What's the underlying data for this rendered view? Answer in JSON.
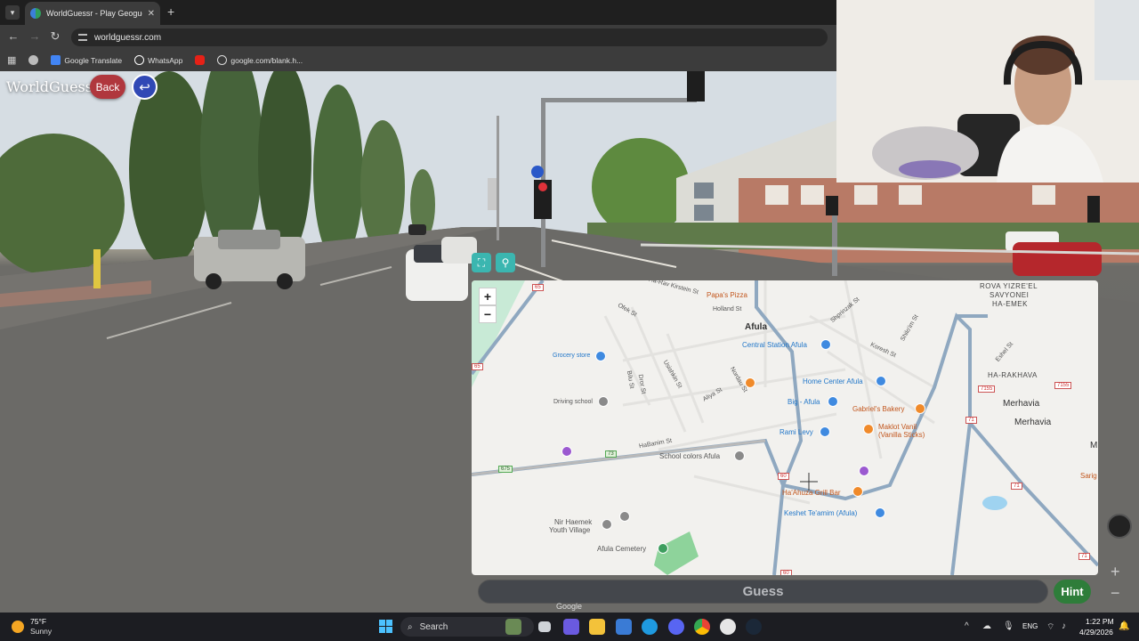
{
  "browser": {
    "tab_title": "WorldGuessr - Play Geoguessr",
    "tab_close": "✕",
    "new_tab": "+",
    "url": "worldguessr.com",
    "bookmarks": [
      "Google Translate",
      "WhatsApp",
      "google.com/blank.h..."
    ]
  },
  "game": {
    "logo": "WorldGuessr",
    "back_label": "Back",
    "guess_label": "Guess",
    "hint_label": "Hint",
    "google_watermark": "Google"
  },
  "map": {
    "places": {
      "afula": "Afula",
      "rova": "ROVA YIZRE'EL",
      "savyonei": "SAVYONEI",
      "haemek": "HA-EMEK",
      "harakhava": "HA-RAKHAVA",
      "merhavia1": "Merhavia",
      "merhavia2": "Merhavia",
      "m_edge": "M"
    },
    "pois": {
      "papas_pizza": "Papa's Pizza",
      "central_station": "Central Station Afula",
      "grocery": "Grocery store",
      "driving_school": "Driving school",
      "home_center": "Home Center Afula",
      "big_afula": "Big - Afula",
      "gabriels_bakery": "Gabriel's Bakery",
      "rami_levy": "Rami Levy",
      "maklot_vanil": "Maklot Vanil",
      "vanilla_sticks": "(Vanilla Sticks)",
      "school_colors": "School colors Afula",
      "ha_ahuza": "Ha'Ahuza Grill Bar",
      "keshet": "Keshet Te'amim (Afula)",
      "nir_haemek": "Nir Haemek",
      "youth_village": "Youth Village",
      "cemetery": "Afula Cemetery",
      "sarig": "Sarig E"
    },
    "streets": {
      "ha_rav_kirstein": "Ha-Rav Kirstein St",
      "holland": "Holland St",
      "ofek": "Ofek St",
      "shprinzak": "Shprinzak St",
      "koresh": "Koresh St",
      "shiloh": "Shilo'im St",
      "eshel": "Eshel St",
      "bilu": "Bilu St",
      "dror": "Dror St",
      "usishkin": "Usishkin St",
      "aliya": "Aliya St",
      "nordau": "Nordau St",
      "habanim": "HaBanim St"
    },
    "route_badges": [
      "65",
      "65",
      "60",
      "60",
      "71",
      "71",
      "73",
      "71",
      "675",
      "65"
    ],
    "route_badges_special": [
      "7155",
      "7155"
    ],
    "zoom_in": "+",
    "zoom_out": "−"
  },
  "taskbar": {
    "temp": "75°F",
    "condition": "Sunny",
    "search": "Search",
    "lang": "ENG",
    "time": "1:22 PM",
    "date": "4/29/2026"
  },
  "colors": {
    "back": "#b0373d",
    "undo": "#3048b5",
    "hint": "#2e7d3a",
    "map_road": "#8fa8c0",
    "accent_teal": "#3bb6b0"
  }
}
